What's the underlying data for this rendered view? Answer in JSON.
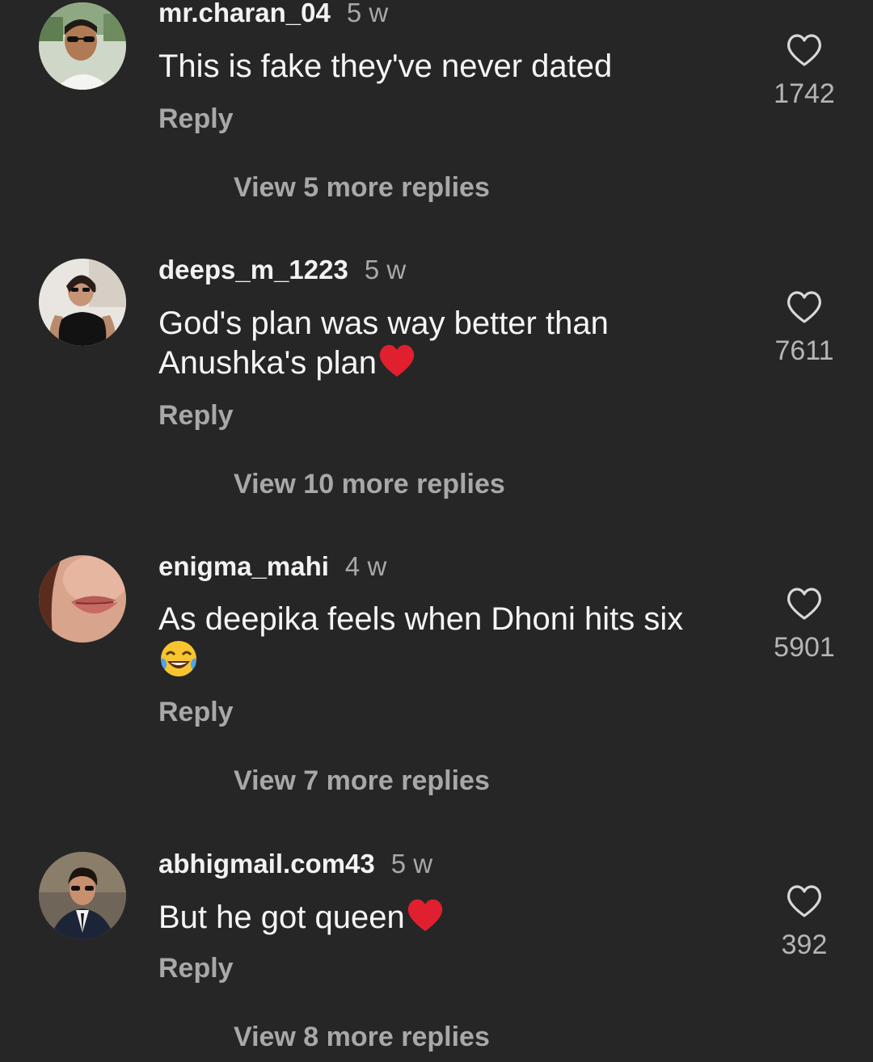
{
  "comments": [
    {
      "username": "mr.charan_04",
      "time": "5 w",
      "text": "This is fake they've never dated",
      "reply_label": "Reply",
      "view_replies": "View 5 more replies",
      "likes": "1742",
      "avatar": "man-sunglasses-avatar"
    },
    {
      "username": "deeps_m_1223",
      "time": "5 w",
      "text": "God's plan was way better than Anushka's plan",
      "emoji": "red-heart-emoji",
      "reply_label": "Reply",
      "view_replies": "View 10 more replies",
      "likes": "7611",
      "avatar": "woman-black-top-avatar"
    },
    {
      "username": "enigma_mahi",
      "time": "4 w",
      "text": "As deepika feels when Dhoni hits six",
      "emoji": "tears-of-joy-emoji",
      "reply_label": "Reply",
      "view_replies": "View 7 more replies",
      "likes": "5901",
      "avatar": "lips-closeup-avatar"
    },
    {
      "username": "abhigmail.com43",
      "time": "5 w",
      "text": "But he got queen",
      "emoji": "red-heart-emoji",
      "reply_label": "Reply",
      "view_replies": "View 8 more replies",
      "likes": "392",
      "avatar": "man-suit-sunglasses-avatar"
    }
  ],
  "colors": {
    "background": "#262626",
    "primary_text": "#f5f5f5",
    "secondary_text": "#a8a8a8",
    "heart_emoji": "#e0202f"
  },
  "icons": {
    "like": "heart-outline-icon"
  }
}
